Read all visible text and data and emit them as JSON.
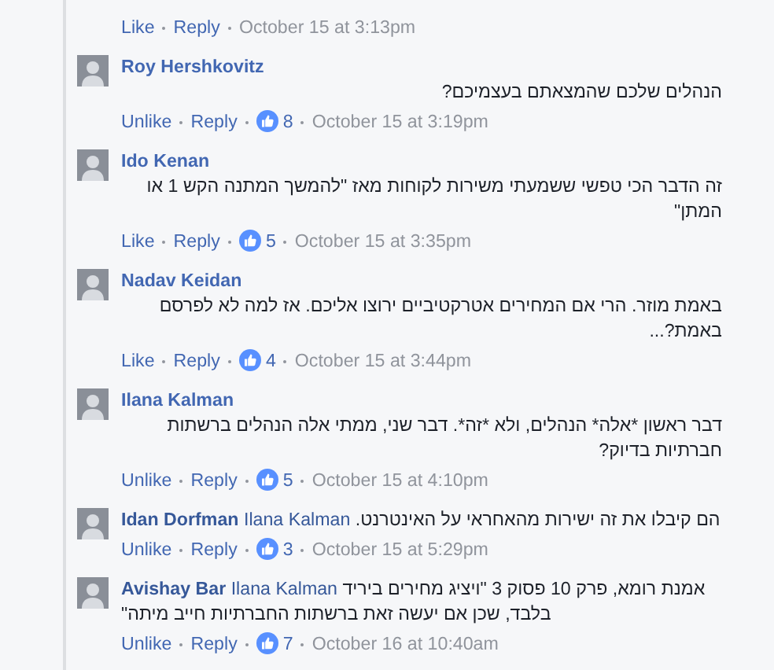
{
  "comments": [
    {
      "actions": {
        "like_label": "Like",
        "reply_label": "Reply",
        "time": "October 15 at 3:13pm"
      }
    },
    {
      "author": "Roy Hershkovitz",
      "text": "הנהלים שלכם שהמצאתם בעצמיכם?",
      "actions": {
        "like_label": "Unlike",
        "reply_label": "Reply",
        "likes": "8",
        "time": "October 15 at 3:19pm"
      }
    },
    {
      "author": "Ido Kenan",
      "text": "זה הדבר הכי טפשי ששמעתי משירות לקוחות מאז \"להמשך המתנה הקש 1 או המתן\"",
      "actions": {
        "like_label": "Like",
        "reply_label": "Reply",
        "likes": "5",
        "time": "October 15 at 3:35pm"
      }
    },
    {
      "author": "Nadav Keidan",
      "text": "באמת מוזר. הרי אם המחירים אטרקטיביים ירוצו אליכם. אז למה לא לפרסם באמת?...",
      "actions": {
        "like_label": "Like",
        "reply_label": "Reply",
        "likes": "4",
        "time": "October 15 at 3:44pm"
      }
    },
    {
      "author": "Ilana Kalman",
      "text": "דבר ראשון *אלה* הנהלים, ולא *זה*. דבר שני, ממתי אלה הנהלים ברשתות חברתיות בדיוק?",
      "actions": {
        "like_label": "Unlike",
        "reply_label": "Reply",
        "likes": "5",
        "time": "October 15 at 4:10pm"
      }
    },
    {
      "author": "Idan Dorfman",
      "reply_to": "Ilana Kalman",
      "text": "הם קיבלו את זה ישירות מהאחראי על האינטרנט.",
      "actions": {
        "like_label": "Unlike",
        "reply_label": "Reply",
        "likes": "3",
        "time": "October 15 at 5:29pm"
      }
    },
    {
      "author": "Avishay Bar",
      "reply_to": "Ilana Kalman",
      "text": "אמנת רומא, פרק 10 פסוק 3 \"ויציג מחירים ביריד בלבד, שכן אם יעשה זאת ברשתות החברתיות חייב מיתה\"",
      "actions": {
        "like_label": "Unlike",
        "reply_label": "Reply",
        "likes": "7",
        "time": "October 16 at 10:40am"
      }
    }
  ]
}
